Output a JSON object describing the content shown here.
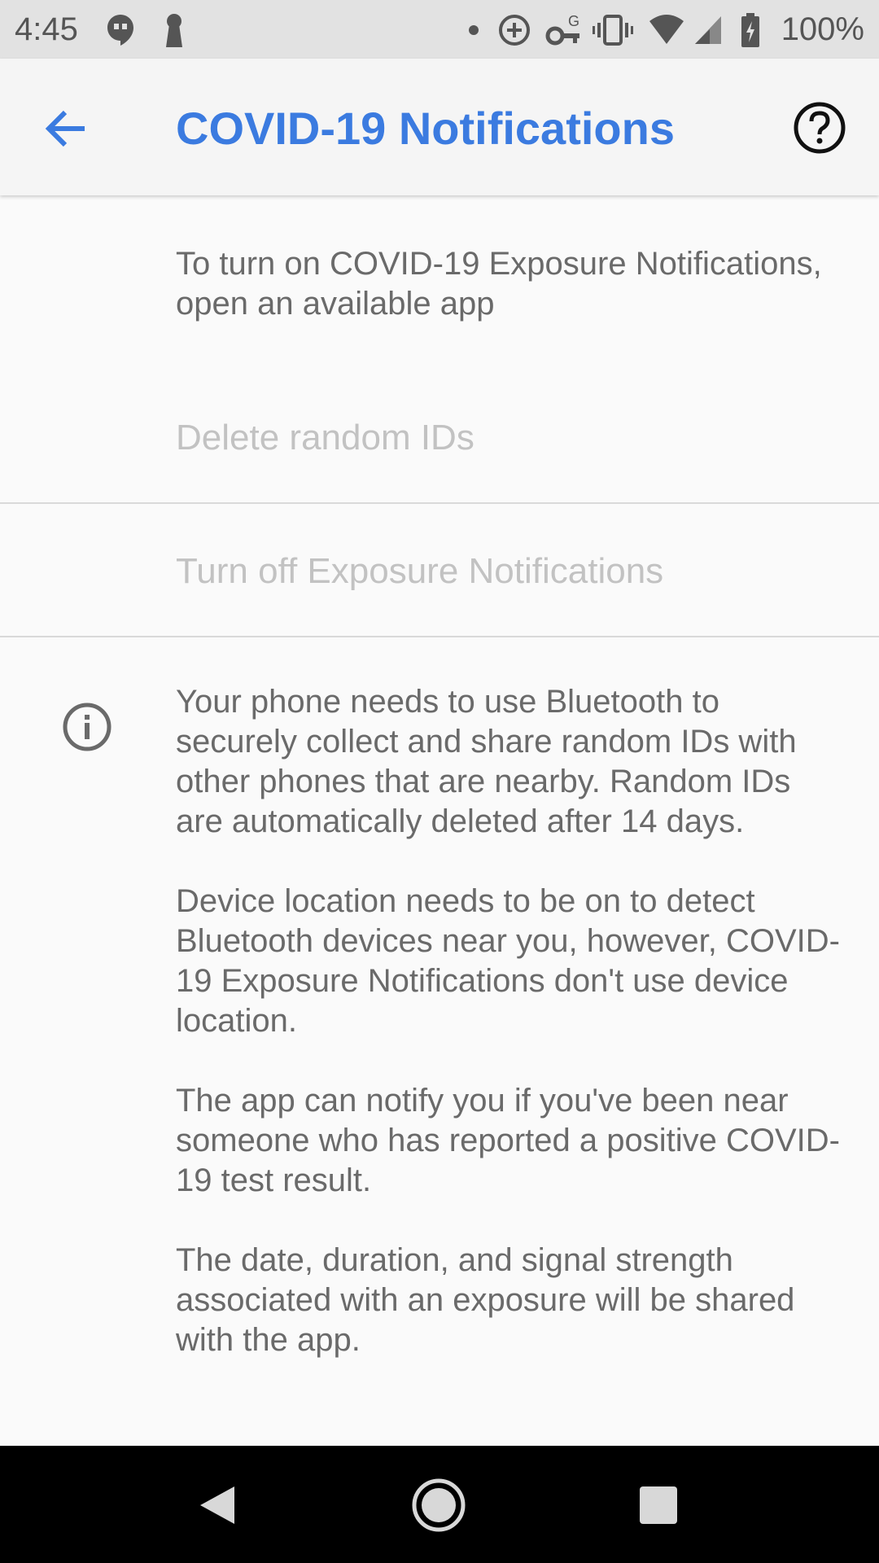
{
  "status_bar": {
    "time": "4:45",
    "battery_text": "100%",
    "icons": [
      "hangouts-icon",
      "keyhole-icon",
      "dot-icon",
      "data-saver-icon",
      "vpn-key-icon",
      "vibrate-icon",
      "wifi-icon",
      "signal-icon",
      "battery-charging-icon"
    ]
  },
  "app_bar": {
    "title": "COVID-19 Notifications",
    "back_icon": "arrow-back-icon",
    "help_icon": "help-icon"
  },
  "intro_text": "To turn on COVID-19 Exposure Notifications, open an available app",
  "actions": {
    "delete_ids": "Delete random IDs",
    "turn_off": "Turn off Exposure Notifications"
  },
  "info": {
    "icon": "info-icon",
    "paragraphs": [
      "Your phone needs to use Bluetooth to securely collect and share random IDs with other phones that are nearby. Random IDs are automatically deleted after 14 days.",
      "Device location needs to be on to detect Bluetooth devices near you, however, COVID-19 Exposure Notifications don't use device location.",
      "The app can notify you if you've been near someone who has reported a positive COVID-19 test result.",
      "The date, duration, and signal strength associated with an exposure will be shared with the app."
    ]
  },
  "nav_bar": {
    "back": "nav-back-icon",
    "home": "nav-home-icon",
    "recents": "nav-recents-icon"
  },
  "colors": {
    "accent": "#3b7be0",
    "body_text": "#6a6a6a",
    "disabled_text": "#c2c2c2",
    "status_bar_bg": "#e2e2e2"
  }
}
